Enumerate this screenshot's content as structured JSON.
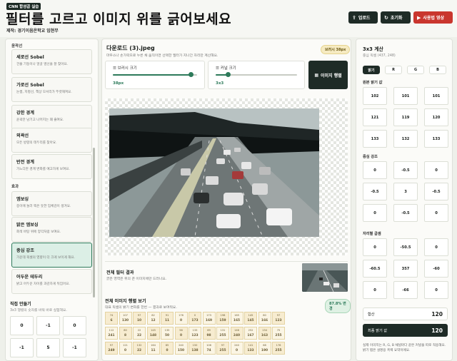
{
  "header": {
    "badge": "CNN 합성곱 실습",
    "title": "필터를 고르고 이미지 위를 긁어보세요",
    "maker": "제작: 경기이음온학교 임현무",
    "buttons": {
      "upload": "업로드",
      "reset": "초기화",
      "video": "사용법 영상"
    },
    "icons": {
      "upload": "upload-icon",
      "reset": "refresh-icon",
      "video": "video-icon"
    }
  },
  "left": {
    "section_edges": "윤곽선",
    "filters": [
      {
        "name": "세로선 Sobel",
        "desc": "건물 기둥이나 얼굴 옆선을 잘 찾아요."
      },
      {
        "name": "가로선 Sobel",
        "desc": "눈썹, 지평선, 책상 모서리가 뚜렷해져요."
      },
      {
        "name": "강한 경계",
        "desc": "윤곽만 남기고 나머지는 꽤 줄여요."
      },
      {
        "name": "외곽선",
        "desc": "모든 방향의 테두리를 찾아요."
      },
      {
        "name": "반전 경계",
        "desc": "가느다란 경계 변화를 예고하게 보여요."
      }
    ],
    "section_effects": "효과",
    "effects": [
      {
        "name": "엠보싱",
        "desc": "중이에 눌러 찍은 듯한 입체감이 생겨요."
      },
      {
        "name": "밝은 엠보싱",
        "desc": "회색 바탕 위에 양각처럼 보여요."
      },
      {
        "name": "중심 강조",
        "desc": "가운데 픽셀의 영향이 더 크게 보이게 해요."
      },
      {
        "name": "어두운 테두리",
        "desc": "밝고 어두운 차이를 과감하게 뒤집어요."
      }
    ],
    "custom_title": "직접 만들기",
    "custom_sub": "3x3 행렬의 숫자를 바꿔 바로 실험해요.",
    "custom_kernel": [
      "0",
      "-1",
      "0",
      "-1",
      "5",
      "-1"
    ]
  },
  "center": {
    "image_title": "다운로드 (3).jpeg",
    "image_sub": "마우스나 손가락으로 누른 채 움직이면 선택한 필터가 지나간 자리만 계산해요.",
    "brush_pill": "브러시 38px",
    "brush": {
      "label": "브러시 크기",
      "value": "38px",
      "fraction": 0.92
    },
    "kernel": {
      "label": "커널 크기",
      "value": "3x3",
      "fraction": 0.15
    },
    "matrix_button": "이미지 행렬",
    "result_title": "전체 필터 결과",
    "result_sub": "긁은 영역은 위의 큰 이미지에만 드러나요.",
    "full_title": "전체 이미지 행렬 보기",
    "full_sub": "대표 픽셀의 밝기 변화를 한번 — 결과로 보여줘요.",
    "progress_pill": "87.8% 변경",
    "grid_rows": [
      [
        "74",
        "107",
        "97",
        "82",
        "91",
        "176",
        "0",
        "173",
        "198",
        "165",
        "145",
        "80",
        "97"
      ],
      [
        "6",
        "130",
        "10",
        "12",
        "11",
        "0",
        "173",
        "169",
        "159",
        "165",
        "145",
        "166",
        "123"
      ],
      [
        "112",
        "80",
        "22",
        "145",
        "135",
        "56",
        "133",
        "69",
        "131",
        "146",
        "252",
        "134",
        "75"
      ],
      [
        "241",
        "8",
        "22",
        "148",
        "50",
        "0",
        "123",
        "98",
        "255",
        "240",
        "167",
        "163",
        "255"
      ],
      [
        "97",
        "121",
        "132",
        "164",
        "85",
        "240",
        "150",
        "106",
        "97",
        "240",
        "141",
        "68",
        "176"
      ],
      [
        "249",
        "0",
        "22",
        "11",
        "0",
        "150",
        "138",
        "74",
        "255",
        "0",
        "133",
        "190",
        "255"
      ]
    ]
  },
  "right": {
    "title": "3x3 계산",
    "sub": "중심 픽셀 (437, 248)",
    "tabs": [
      "밝기",
      "R",
      "G",
      "B"
    ],
    "original_label": "원본 밝기 값",
    "original": [
      "102",
      "101",
      "101",
      "121",
      "119",
      "120",
      "133",
      "132",
      "133"
    ],
    "kernel_label": "중심 강조",
    "kernel": [
      "0",
      "-0.5",
      "0",
      "-0.5",
      "3",
      "-0.5",
      "0",
      "-0.5",
      "0"
    ],
    "product_label": "자리별 곱셈",
    "products": [
      "0",
      "-50.5",
      "0",
      "-60.5",
      "357",
      "-60",
      "0",
      "-66",
      "0"
    ],
    "sum_label": "합산",
    "sum_value": "120",
    "final_label": "최종 밝기 값",
    "final_value": "120",
    "note": "실제 이미지는 R, G, B 채널마다 같은 커널을 따로 적용해요. 밝기 탭은 설명용 흑백 요약이에요."
  }
}
